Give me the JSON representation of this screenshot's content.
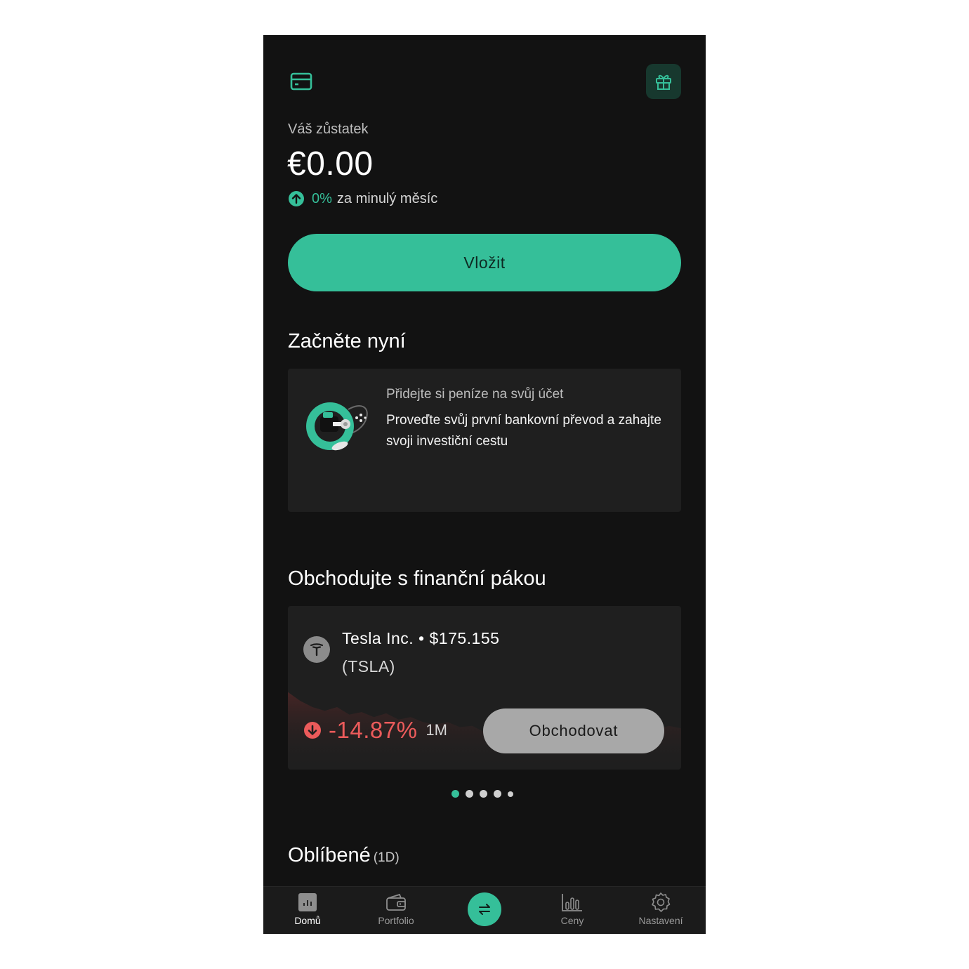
{
  "header": {
    "card_icon": "credit-card-icon",
    "gift_icon": "gift-icon"
  },
  "balance": {
    "label": "Váš zůstatek",
    "value": "€0.00",
    "change_pct": "0%",
    "change_text": "za minulý měsíc"
  },
  "deposit": {
    "label": "Vložit"
  },
  "start_section": {
    "title": "Začněte nyní",
    "card_title": "Přidejte si peníze na svůj účet",
    "card_desc": "Proveďte svůj první bankovní převod a zahajte svoji investiční cestu"
  },
  "leverage_section": {
    "title": "Obchodujte s finanční pákou",
    "stock_name": "Tesla Inc. • $175.155",
    "stock_ticker": "(TSLA)",
    "performance": "-14.87%",
    "period": "1M",
    "trade_label": "Obchodovat",
    "sparkline": [
      0.62,
      0.55,
      0.5,
      0.47,
      0.5,
      0.44,
      0.46,
      0.42,
      0.45,
      0.4,
      0.42,
      0.38,
      0.36,
      0.38,
      0.34,
      0.35,
      0.3,
      0.32,
      0.28,
      0.3,
      0.27,
      0.3,
      0.33,
      0.3,
      0.32,
      0.36,
      0.34,
      0.33,
      0.38,
      0.34,
      0.32,
      0.35,
      0.33
    ],
    "carousel_dots": 5,
    "active_dot": 0
  },
  "favorites_section": {
    "title": "Oblíbené",
    "subtitle": "(1D)"
  },
  "nav": {
    "home": "Domů",
    "portfolio": "Portfolio",
    "prices": "Ceny",
    "settings": "Nastavení"
  },
  "colors": {
    "accent": "#35bf99",
    "negative": "#ec5b5b",
    "background": "#121212",
    "card": "#1f1f1f"
  }
}
